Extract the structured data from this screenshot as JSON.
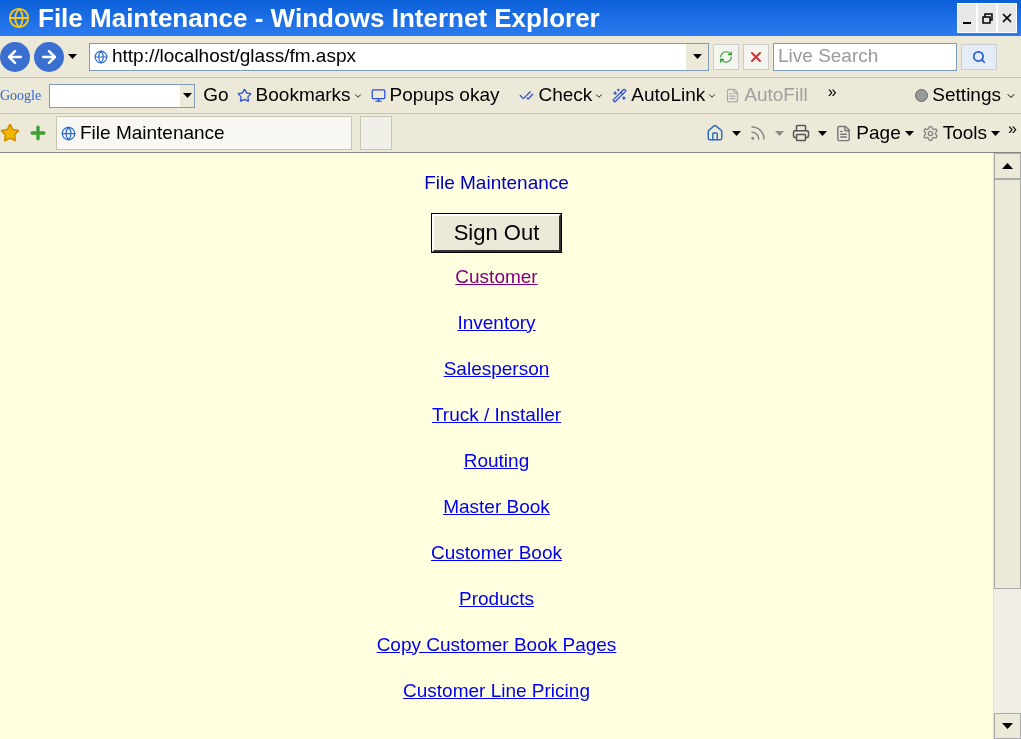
{
  "window": {
    "title": "File Maintenance - Windows Internet Explorer"
  },
  "address_bar": {
    "url": "http://localhost/glass/fm.aspx",
    "search_placeholder": "Live Search"
  },
  "google_toolbar": {
    "logo": "Google",
    "go": "Go",
    "items": [
      {
        "label": "Bookmarks",
        "disabled": false,
        "dropdown": true
      },
      {
        "label": "Popups okay",
        "disabled": false,
        "dropdown": false
      },
      {
        "label": "Check",
        "disabled": false,
        "dropdown": true
      },
      {
        "label": "AutoLink",
        "disabled": false,
        "dropdown": true
      },
      {
        "label": "AutoFill",
        "disabled": true,
        "dropdown": false
      }
    ],
    "more": "»",
    "settings": "Settings"
  },
  "tab_bar": {
    "tab": "File Maintenance",
    "commands": [
      "Page",
      "Tools"
    ],
    "more": "»"
  },
  "page": {
    "heading": "File Maintenance",
    "sign_out": "Sign Out",
    "links": [
      {
        "label": "Customer",
        "visited": true
      },
      {
        "label": "Inventory",
        "visited": false
      },
      {
        "label": "Salesperson",
        "visited": false
      },
      {
        "label": "Truck / Installer",
        "visited": false
      },
      {
        "label": "Routing",
        "visited": false
      },
      {
        "label": "Master Book",
        "visited": false
      },
      {
        "label": "Customer Book",
        "visited": false
      },
      {
        "label": "Products",
        "visited": false
      },
      {
        "label": "Copy Customer Book Pages",
        "visited": false
      },
      {
        "label": "Customer Line Pricing",
        "visited": false
      }
    ]
  }
}
